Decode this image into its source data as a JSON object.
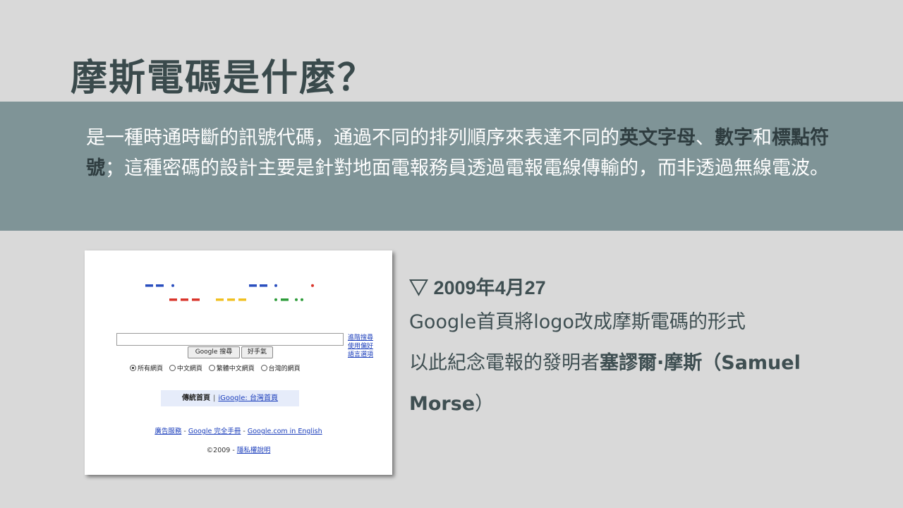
{
  "slide": {
    "title": "摩斯電碼是什麼？",
    "description": {
      "part1": "是一種時通時斷的訊號代碼，通過不同的排列順序來表達不同的",
      "bold1": "英文字母",
      "part2": "、",
      "bold2": "數字",
      "part3": "和",
      "bold3": "標點符號",
      "part4": "；這種密碼的設計主要是針對地面電報務員透過電報電線傳輸的，而非透過無線電波。"
    },
    "info": {
      "date": "▽ 2009年4月27",
      "line1": "Google首頁將logo改成摩斯電碼的形式",
      "line2_prefix": "以此紀念電報的發明者",
      "line2_bold": "塞謬爾·摩斯（Samuel",
      "line3_bold": "Morse",
      "line3_suffix": "）"
    },
    "colors": {
      "background": "#d9d9d9",
      "band": "#7f9497",
      "title": "#3a4a4c",
      "morse_blue": "#2a4fbf",
      "morse_red": "#d9352b",
      "morse_yellow": "#f0c020",
      "morse_green": "#2e9c3a"
    }
  },
  "screenshot": {
    "side_links": [
      "進階搜尋",
      "使用偏好",
      "語言選項"
    ],
    "search_button": "Google 搜尋",
    "lucky_button": "好手氣",
    "radios": [
      "所有網頁",
      "中文網頁",
      "繁體中文網頁",
      "台灣的網頁"
    ],
    "home_current": "傳統首頁",
    "home_separator": "|",
    "home_link": "iGoogle: 台灣首頁",
    "footer_link1": "廣告服務",
    "footer_sep1": " - ",
    "footer_link2": "Google 完全手冊",
    "footer_sep2": " - ",
    "footer_link3": "Google.com in English",
    "copyright_text": "©2009 - ",
    "privacy_link": "隱私權說明"
  }
}
